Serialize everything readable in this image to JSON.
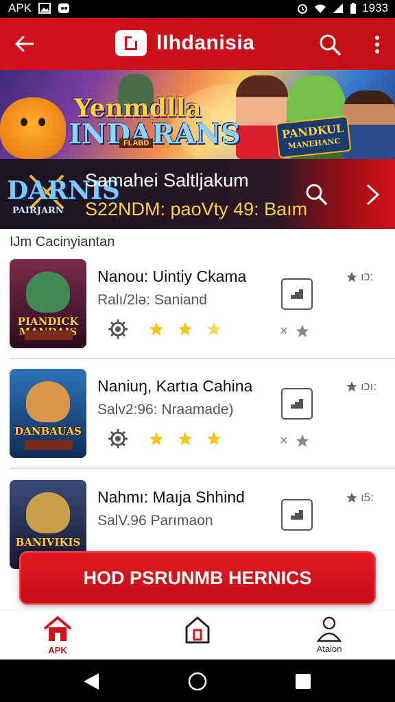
{
  "status_bar": {
    "carrier": "APK",
    "time": "1933"
  },
  "app_bar": {
    "title": "lIhdanisia"
  },
  "banner": {
    "headline_top": "Yenmdlla",
    "headline_main": "INDARANS",
    "small_tag": "FLABD",
    "badge_top": "PANDKUL",
    "badge_bottom": "MANEHANC"
  },
  "featured": {
    "logo_top": "DARNIS",
    "logo_bottom": "PAIRJARN",
    "title": "Samahei Saltljakum",
    "subtitle": "S22NDM: paoVty 49: Baım"
  },
  "section": {
    "label": "IJm Cacinyiantan"
  },
  "apps": [
    {
      "name": "Nanou: Uintiy Ckama",
      "sub": "Ralı/2lə: Saniand",
      "rating": "ıכ:",
      "thumb_text": "PIANDICK MANDAIS",
      "thumb_bg": "#4b2130",
      "face_color": "#3f8a55"
    },
    {
      "name": "Naniuŋ, Kartıa Cahina",
      "sub": "Salv2:96: Nraamade)",
      "rating": "ıכı:",
      "thumb_text": "DANBAUAS",
      "thumb_bg": "#1b4d8a",
      "face_color": "#d99548"
    },
    {
      "name": "Nahmı: Maıja Shhind",
      "sub": "SalV.96 Parımaon",
      "rating": "ı5:",
      "thumb_text": "BANIVIKIS",
      "thumb_bg": "#1f2b4a",
      "face_color": "#c8a04a"
    }
  ],
  "cta": {
    "label": "HOD PSRUNMB HERNICS"
  },
  "bottom_nav": {
    "home_label": "APK",
    "account_label": "Ataion"
  },
  "colors": {
    "brand": "#d3121b",
    "star": "#f5c518"
  }
}
